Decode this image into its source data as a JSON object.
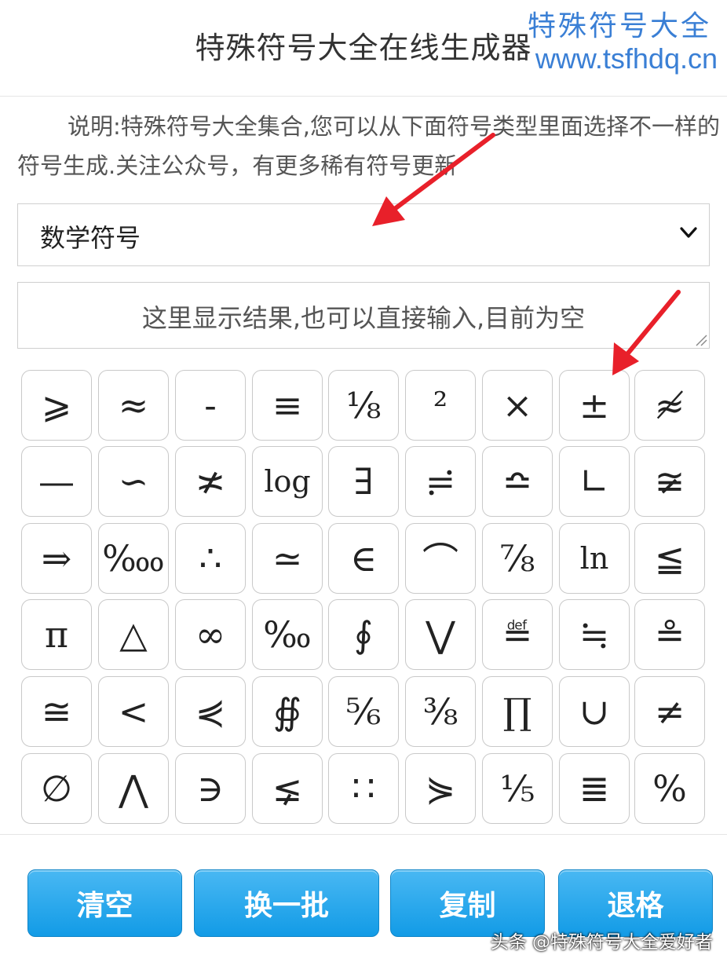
{
  "header": {
    "title": "特殊符号大全在线生成器",
    "watermark_name": "特殊符号大全",
    "watermark_url": "www.tsfhdq.cn"
  },
  "description": "说明:特殊符号大全集合,您可以从下面符号类型里面选择不一样的符号生成.关注公众号，有更多稀有符号更新",
  "category_select": {
    "selected": "数学符号"
  },
  "result": {
    "placeholder": "这里显示结果,也可以直接输入,目前为空"
  },
  "symbols": [
    "⩾",
    "≈",
    "-",
    "≡",
    "⅛",
    "²",
    "×",
    "±",
    "≉",
    "—",
    "∽",
    "≭",
    "log",
    "∃",
    "≓",
    "≏",
    "∟",
    "≆",
    "⇒",
    "‱",
    "∴",
    "≃",
    "∈",
    "⌒",
    "⅞",
    "ln",
    "≦",
    "π",
    "△",
    "∞",
    "‰",
    "∮",
    "⋁",
    "≝",
    "≒",
    "≗",
    "≅",
    "<",
    "⋞",
    "∯",
    "⅚",
    "⅜",
    "∏",
    "∪",
    "≠",
    "∅",
    "⋀",
    "∋",
    "⪇",
    "∷",
    "⋟",
    "⅕",
    "≣",
    "%"
  ],
  "buttons": {
    "clear": "清空",
    "shuffle": "换一批",
    "copy": "复制",
    "backspace": "退格"
  },
  "credit": "头条 @特殊符号大全爱好者",
  "colors": {
    "watermark": "#3a7fd5",
    "button_blue": "#1aa3ea",
    "annotation_arrow": "#e8202a"
  }
}
